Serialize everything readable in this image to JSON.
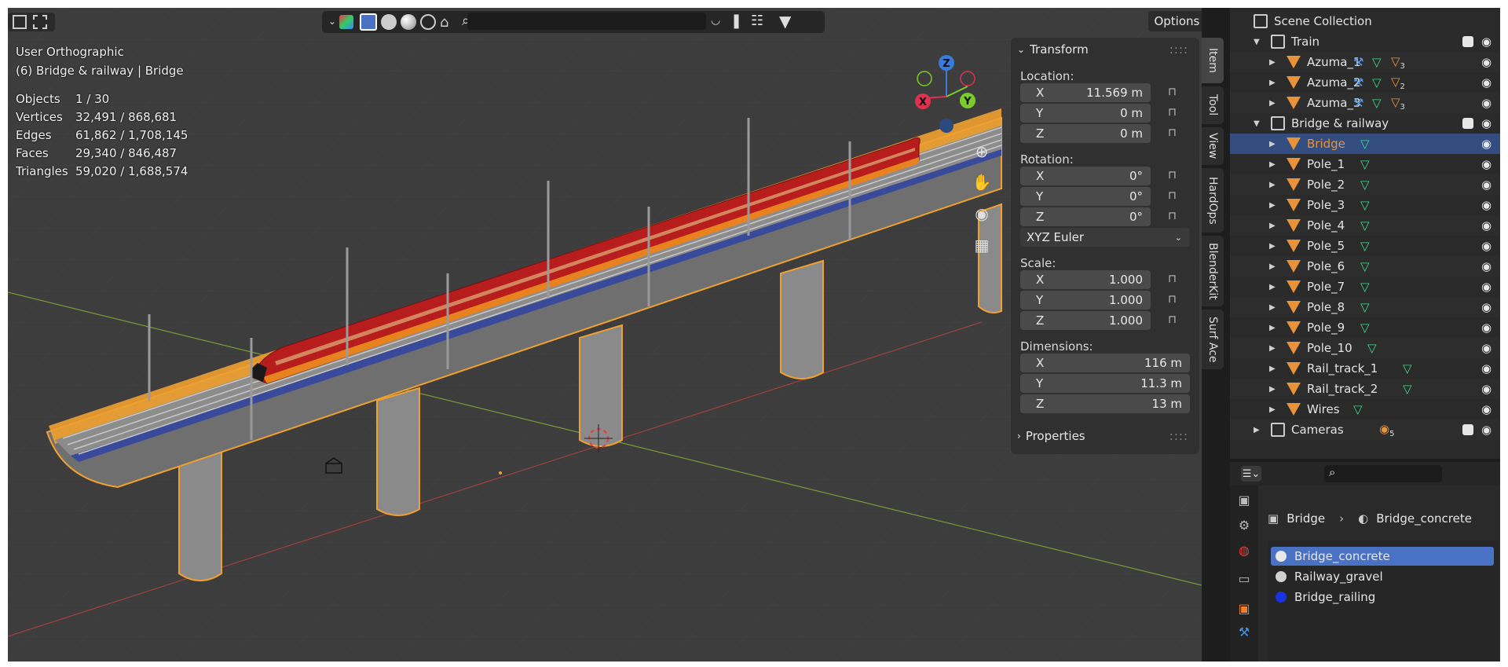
{
  "viewport": {
    "view_name": "User Orthographic",
    "context": "(6) Bridge & railway | Bridge",
    "stats": [
      {
        "label": "Objects",
        "value": "1 / 30"
      },
      {
        "label": "Vertices",
        "value": "32,491 / 868,681"
      },
      {
        "label": "Edges",
        "value": "61,862 / 1,708,145"
      },
      {
        "label": "Faces",
        "value": "29,340 / 846,487"
      },
      {
        "label": "Triangles",
        "value": "59,020 / 1,688,574"
      }
    ],
    "options_label": "Options",
    "search_placeholder": "",
    "gizmo": {
      "z": "Z",
      "y": "Y",
      "x": "X"
    }
  },
  "npanel": {
    "transform_title": "Transform",
    "location_label": "Location:",
    "location": [
      {
        "axis": "X",
        "value": "11.569 m"
      },
      {
        "axis": "Y",
        "value": "0 m"
      },
      {
        "axis": "Z",
        "value": "0 m"
      }
    ],
    "rotation_label": "Rotation:",
    "rotation": [
      {
        "axis": "X",
        "value": "0°"
      },
      {
        "axis": "Y",
        "value": "0°"
      },
      {
        "axis": "Z",
        "value": "0°"
      }
    ],
    "rotation_mode": "XYZ Euler",
    "scale_label": "Scale:",
    "scale": [
      {
        "axis": "X",
        "value": "1.000"
      },
      {
        "axis": "Y",
        "value": "1.000"
      },
      {
        "axis": "Z",
        "value": "1.000"
      }
    ],
    "dimensions_label": "Dimensions:",
    "dimensions": [
      {
        "axis": "X",
        "value": "116 m"
      },
      {
        "axis": "Y",
        "value": "11.3 m"
      },
      {
        "axis": "Z",
        "value": "13 m"
      }
    ],
    "properties_title": "Properties",
    "tabs": [
      "Item",
      "Tool",
      "View",
      "HardOps",
      "BlenderKit",
      "Surf Ace"
    ]
  },
  "outliner": {
    "scene_collection": "Scene Collection",
    "rows": [
      {
        "name": "Train",
        "type": "collection",
        "depth": 1,
        "expanded": true
      },
      {
        "name": "Azuma_1",
        "type": "object",
        "depth": 2,
        "badge": "3"
      },
      {
        "name": "Azuma_2",
        "type": "object",
        "depth": 2,
        "badge": "2"
      },
      {
        "name": "Azuma_3",
        "type": "object",
        "depth": 2,
        "badge": "3"
      },
      {
        "name": "Bridge & railway",
        "type": "collection",
        "depth": 1,
        "expanded": true
      },
      {
        "name": "Bridge",
        "type": "object",
        "depth": 2,
        "selected": true
      },
      {
        "name": "Pole_1",
        "type": "object",
        "depth": 2
      },
      {
        "name": "Pole_2",
        "type": "object",
        "depth": 2
      },
      {
        "name": "Pole_3",
        "type": "object",
        "depth": 2
      },
      {
        "name": "Pole_4",
        "type": "object",
        "depth": 2
      },
      {
        "name": "Pole_5",
        "type": "object",
        "depth": 2
      },
      {
        "name": "Pole_6",
        "type": "object",
        "depth": 2
      },
      {
        "name": "Pole_7",
        "type": "object",
        "depth": 2
      },
      {
        "name": "Pole_8",
        "type": "object",
        "depth": 2
      },
      {
        "name": "Pole_9",
        "type": "object",
        "depth": 2
      },
      {
        "name": "Pole_10",
        "type": "object",
        "depth": 2
      },
      {
        "name": "Rail_track_1",
        "type": "object",
        "depth": 2
      },
      {
        "name": "Rail_track_2",
        "type": "object",
        "depth": 2
      },
      {
        "name": "Wires",
        "type": "object",
        "depth": 2
      },
      {
        "name": "Cameras",
        "type": "collection",
        "depth": 1,
        "expanded": false,
        "badge": "5"
      }
    ]
  },
  "properties": {
    "breadcrumb_object": "Bridge",
    "breadcrumb_material": "Bridge_concrete",
    "materials": [
      {
        "name": "Bridge_concrete",
        "color": "#e8e8e8",
        "selected": true
      },
      {
        "name": "Railway_gravel",
        "color": "#d0d0d0"
      },
      {
        "name": "Bridge_railing",
        "color": "#1a33e0"
      }
    ]
  },
  "colors": {
    "selection": "#f0a030",
    "accent_blue": "#4a72c4",
    "object_orange": "#e8923a",
    "mesh_green": "#3fd68c"
  }
}
